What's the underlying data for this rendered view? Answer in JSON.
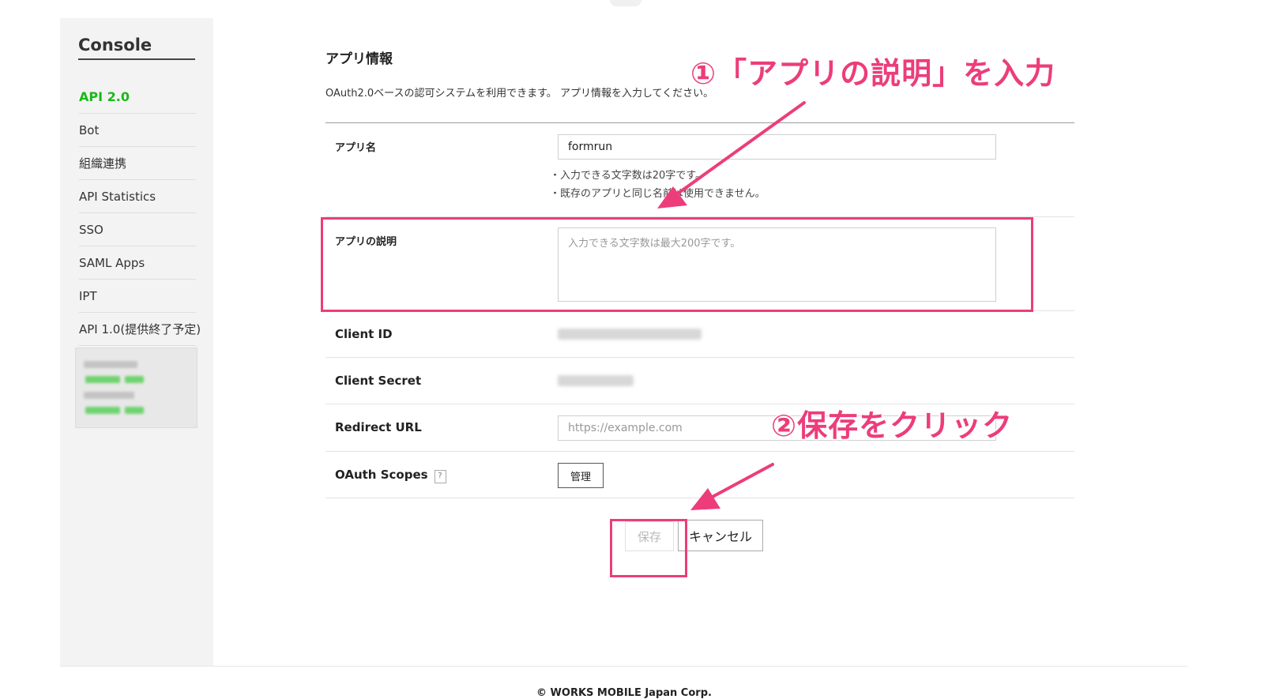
{
  "sidebar": {
    "title": "Console",
    "items": [
      {
        "label": "API 2.0",
        "active": true
      },
      {
        "label": "Bot"
      },
      {
        "label": "組織連携"
      },
      {
        "label": "API Statistics"
      },
      {
        "label": "SSO"
      },
      {
        "label": "SAML Apps"
      },
      {
        "label": "IPT"
      },
      {
        "label": "API 1.0(提供終了予定)"
      }
    ]
  },
  "main": {
    "title": "アプリ情報",
    "description": "OAuth2.0ベースの認可システムを利用できます。 アプリ情報を入力してください。",
    "fields": {
      "app_name": {
        "label": "アプリ名",
        "value": "formrun",
        "notes": [
          "入力できる文字数は20字です。",
          "既存のアプリと同じ名前は使用できません。"
        ]
      },
      "app_description": {
        "label": "アプリの説明",
        "placeholder": "入力できる文字数は最大200字です。"
      },
      "client_id": {
        "label": "Client ID"
      },
      "client_secret": {
        "label": "Client Secret"
      },
      "redirect_url": {
        "label": "Redirect URL",
        "placeholder": "https://example.com"
      },
      "oauth_scopes": {
        "label": "OAuth Scopes",
        "help": "?",
        "manage_label": "管理"
      }
    },
    "buttons": {
      "save_label": "保存",
      "cancel_label": "キャンセル"
    }
  },
  "annotations": {
    "step1": "①「アプリの説明」を入力",
    "step2": "②保存をクリック",
    "color": "#ec3d7a"
  },
  "footer": {
    "copyright": "© WORKS MOBILE Japan Corp."
  },
  "colors": {
    "active_nav": "#19b919",
    "sidebar_bg": "#f3f3f3"
  }
}
